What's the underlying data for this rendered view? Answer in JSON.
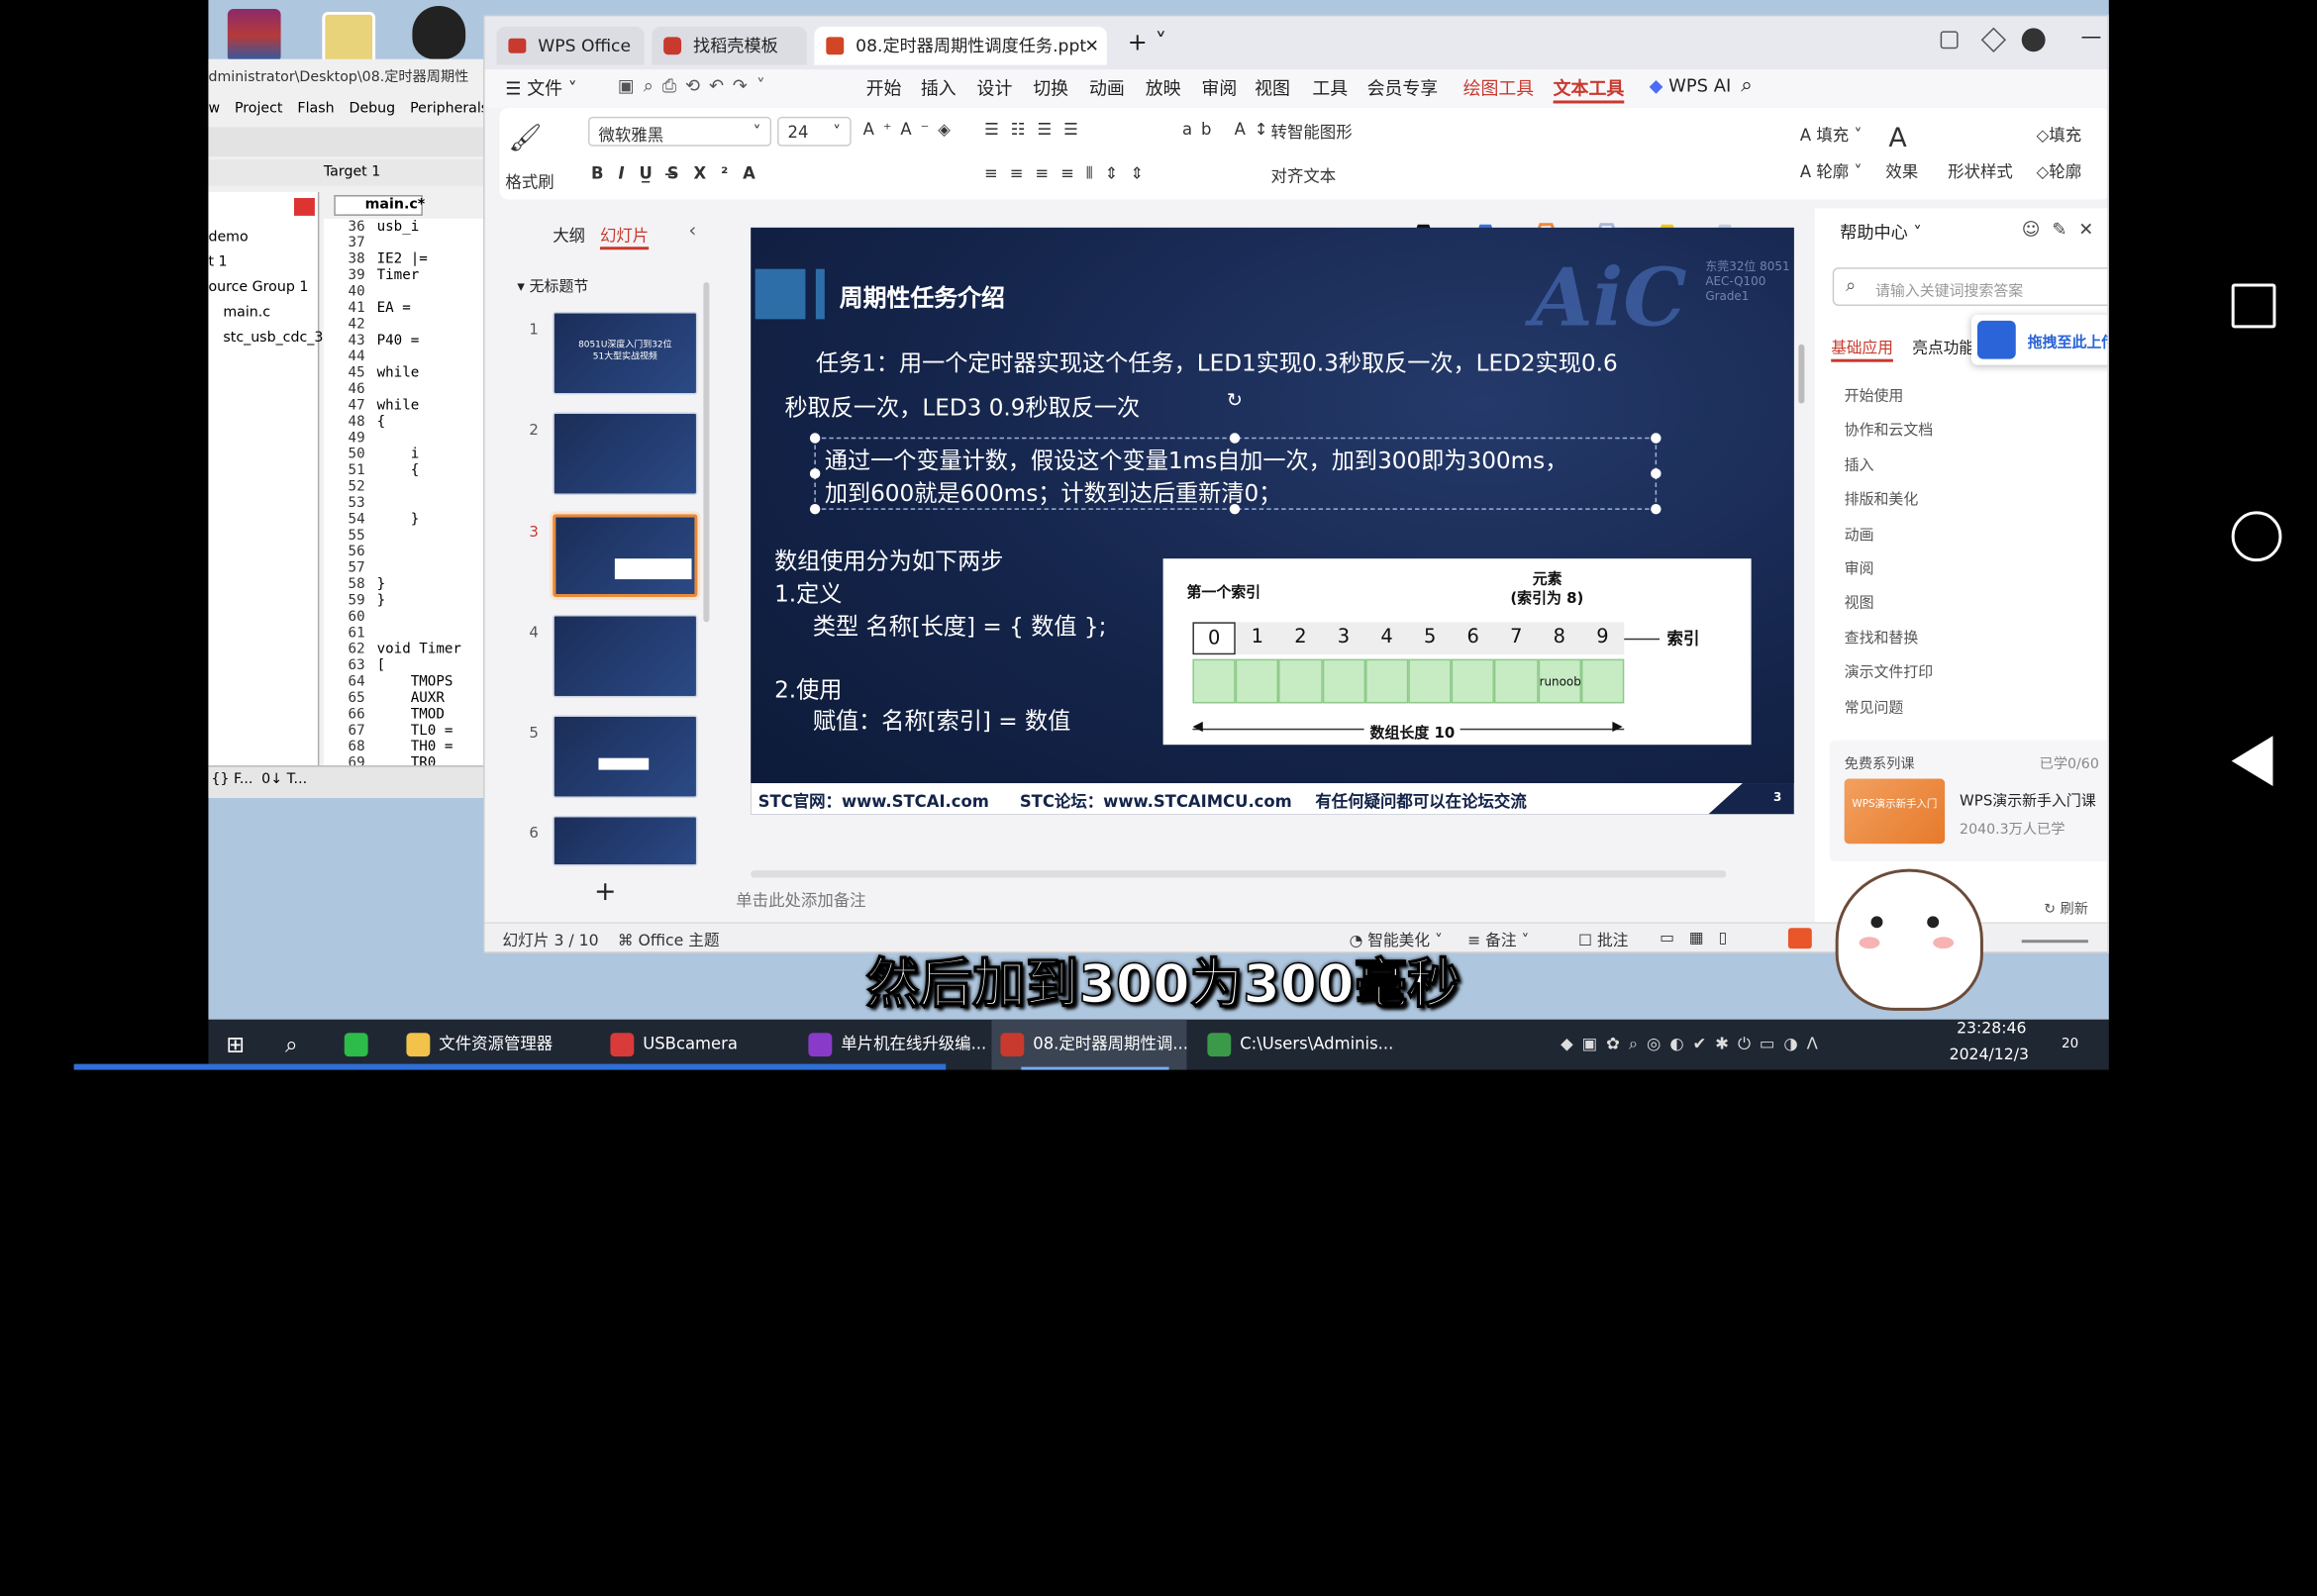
{
  "keil": {
    "path": "dministrator\\Desktop\\08.定时器周期性",
    "menu": [
      "w",
      "Project",
      "Flash",
      "Debug",
      "Peripherals"
    ],
    "target": "Target 1",
    "file_tab": "main.c*",
    "tree": [
      "demo",
      "t 1",
      "ource Group 1",
      "main.c",
      "stc_usb_cdc_3"
    ],
    "line_numbers": [
      "36",
      "37",
      "38",
      "39",
      "40",
      "41",
      "42",
      "43",
      "44",
      "45",
      "46",
      "47",
      "48",
      "49",
      "50",
      "51",
      "52",
      "53",
      "54",
      "55",
      "56",
      "57",
      "58",
      "59",
      "60",
      "61",
      "62",
      "63",
      "64",
      "65",
      "66",
      "67",
      "68",
      "69"
    ],
    "code": [
      "usb_i",
      "",
      "IE2 |=",
      "Timer",
      "",
      "EA =",
      "",
      "P40 =",
      "",
      "while",
      "",
      "while",
      "{",
      "",
      "    i",
      "    {",
      "",
      "",
      "    }",
      "",
      "",
      "",
      "}",
      "}",
      "",
      "",
      "void Timer",
      "[",
      "    TMOPS",
      "    AUXR",
      "    TMOD",
      "    TL0 =",
      "    TH0 =",
      "    TR0"
    ],
    "bottom_tabs": [
      "{} F...",
      "0↓ T..."
    ]
  },
  "wps": {
    "tabs": [
      "WPS Office",
      "找稻壳模板",
      "08.定时器周期性调度任务.ppt"
    ],
    "menus": [
      "文件",
      "开始",
      "插入",
      "设计",
      "切换",
      "动画",
      "放映",
      "审阅",
      "视图",
      "工具",
      "会员专享",
      "绘图工具",
      "文本工具",
      "WPS AI"
    ],
    "ribbon": {
      "format_painter": "格式刷",
      "font": "微软雅黑",
      "size": "24",
      "smart_shape": "转智能图形",
      "align_text": "对齐文本",
      "fill": "填充",
      "outline": "轮廓",
      "effect": "效果",
      "shape_style": "形状样式",
      "fill2": "填充",
      "outline2": "轮廓"
    },
    "panel_tabs": [
      "大纲",
      "幻灯片"
    ],
    "section": "无标题节",
    "slide_numbers": [
      "1",
      "2",
      "3",
      "4",
      "5",
      "6"
    ],
    "add": "+",
    "notes_placeholder": "单击此处添加备注",
    "status": {
      "slide_count": "幻灯片 3 / 10",
      "theme": "Office 主题",
      "beautify": "智能美化",
      "notes": "备注",
      "comment": "批注"
    },
    "help": {
      "title": "帮助中心",
      "search_placeholder": "请输入关键词搜索答案",
      "tabs": [
        "基础应用",
        "亮点功能"
      ],
      "drag_banner": "拖拽至此上传",
      "items": [
        "开始使用",
        "协作和云文档",
        "插入",
        "排版和美化",
        "动画",
        "审阅",
        "视图",
        "查找和替换",
        "演示文件打印",
        "常见问题"
      ],
      "course_title": "免费系列课",
      "course_progress": "已学0/60",
      "course_name": "WPS演示新手入门课",
      "course_learners": "2040.3万人已学",
      "course_thumb": "WPS演示新手入门",
      "refresh": "刷新"
    },
    "thumb1_text": [
      "8051U深度入门到32位",
      "51大型实战视频"
    ]
  },
  "slide": {
    "title": "周期性任务介绍",
    "watermark": "AiC",
    "watermark_small": [
      "东莞32位 8051",
      "AEC-Q100 Grade1"
    ],
    "task_line1": "任务1：用一个定时器实现这个任务，LED1实现0.3秒取反一次，LED2实现0.6",
    "task_line2": "秒取反一次，LED3  0.9秒取反一次",
    "sel_line1": "通过一个变量计数，假设这个变量1ms自加一次，加到300即为300ms，",
    "sel_line2": "加到600就是600ms；计数到达后重新清0；",
    "array_lines": [
      "数组使用分为如下两步",
      "1.定义",
      "类型  名称[长度] = { 数值 };",
      "2.使用",
      "赋值：名称[索引] = 数值"
    ],
    "diagram": {
      "first_index": "第一个索引",
      "element": "元素",
      "element_index": "(索引为 8)",
      "index_label": "索引",
      "indices": [
        "0",
        "1",
        "2",
        "3",
        "4",
        "5",
        "6",
        "7",
        "8",
        "9"
      ],
      "cell_text": "runoob",
      "length_label": "数组长度 10"
    },
    "footer": {
      "site": "STC官网：www.STCAI.com",
      "forum": "STC论坛：www.STCAIMCU.com",
      "note": "有任何疑问都可以在论坛交流",
      "page": "3"
    }
  },
  "subtitle": "然后加到300为300毫秒",
  "taskbar": {
    "apps": [
      "文件资源管理器",
      "USBcamera",
      "单片机在线升级编...",
      "08.定时器周期性调...",
      "C:\\Users\\Adminis..."
    ],
    "time": "23:28:46",
    "date": "2024/12/3",
    "notif": "20"
  },
  "colors": {
    "accent": "#c8392e",
    "slide_bg": "#14244a",
    "help_accent": "#c8392e",
    "taskbar": "#1f2733",
    "cell_green": "#c7ecc4"
  }
}
